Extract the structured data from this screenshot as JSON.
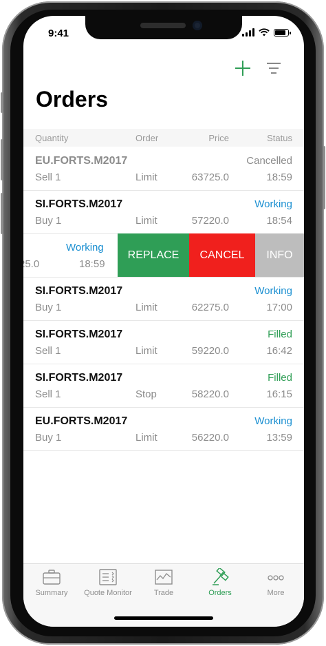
{
  "status_bar": {
    "time": "9:41"
  },
  "toolbar": {
    "add_icon": "plus-icon",
    "filter_icon": "filter-icon"
  },
  "page": {
    "title": "Orders"
  },
  "table": {
    "headers": {
      "quantity": "Quantity",
      "order": "Order",
      "price": "Price",
      "status": "Status"
    },
    "rows": [
      {
        "symbol": "EU.FORTS.M2017",
        "status": "Cancelled",
        "quantity": "Sell 1",
        "order": "Limit",
        "price": "63725.0",
        "time": "18:59",
        "status_color": "#8c8c8c",
        "symbol_muted": true
      },
      {
        "symbol": "SI.FORTS.M2017",
        "status": "Working",
        "quantity": "Buy 1",
        "order": "Limit",
        "price": "57220.0",
        "time": "18:54",
        "status_color": "#1a8fd1",
        "symbol_muted": false
      },
      {
        "symbol": "SI.FORTS.M2017",
        "status": "Working",
        "quantity": "Buy 1",
        "order": "Limit",
        "price": "62275.0",
        "time": "17:00",
        "status_color": "#1a8fd1",
        "symbol_muted": false
      },
      {
        "symbol": "SI.FORTS.M2017",
        "status": "Filled",
        "quantity": "Sell 1",
        "order": "Limit",
        "price": "59220.0",
        "time": "16:42",
        "status_color": "#2f9e56",
        "symbol_muted": false
      },
      {
        "symbol": "SI.FORTS.M2017",
        "status": "Filled",
        "quantity": "Sell 1",
        "order": "Stop",
        "price": "58220.0",
        "time": "16:15",
        "status_color": "#2f9e56",
        "symbol_muted": false
      },
      {
        "symbol": "EU.FORTS.M2017",
        "status": "Working",
        "quantity": "Buy 1",
        "order": "Limit",
        "price": "56220.0",
        "time": "13:59",
        "status_color": "#1a8fd1",
        "symbol_muted": false
      }
    ],
    "swiped_row": {
      "status": "Working",
      "price_partial": "25.0",
      "time": "18:59",
      "status_color": "#1a8fd1",
      "actions": [
        {
          "label": "REPLACE",
          "color": "#2f9e56"
        },
        {
          "label": "CANCEL",
          "color": "#f0201d"
        },
        {
          "label": "INFO",
          "color": "#bdbdbd"
        }
      ]
    }
  },
  "tabs": [
    {
      "label": "Summary",
      "icon": "briefcase-icon"
    },
    {
      "label": "Quote Monitor",
      "icon": "quote-list-icon"
    },
    {
      "label": "Trade",
      "icon": "chart-icon"
    },
    {
      "label": "Orders",
      "icon": "gavel-icon",
      "active": true
    },
    {
      "label": "More",
      "icon": "more-dots-icon"
    }
  ],
  "colors": {
    "accent": "#2f9e56",
    "working": "#1a8fd1",
    "filled": "#2f9e56",
    "cancel": "#f0201d"
  }
}
